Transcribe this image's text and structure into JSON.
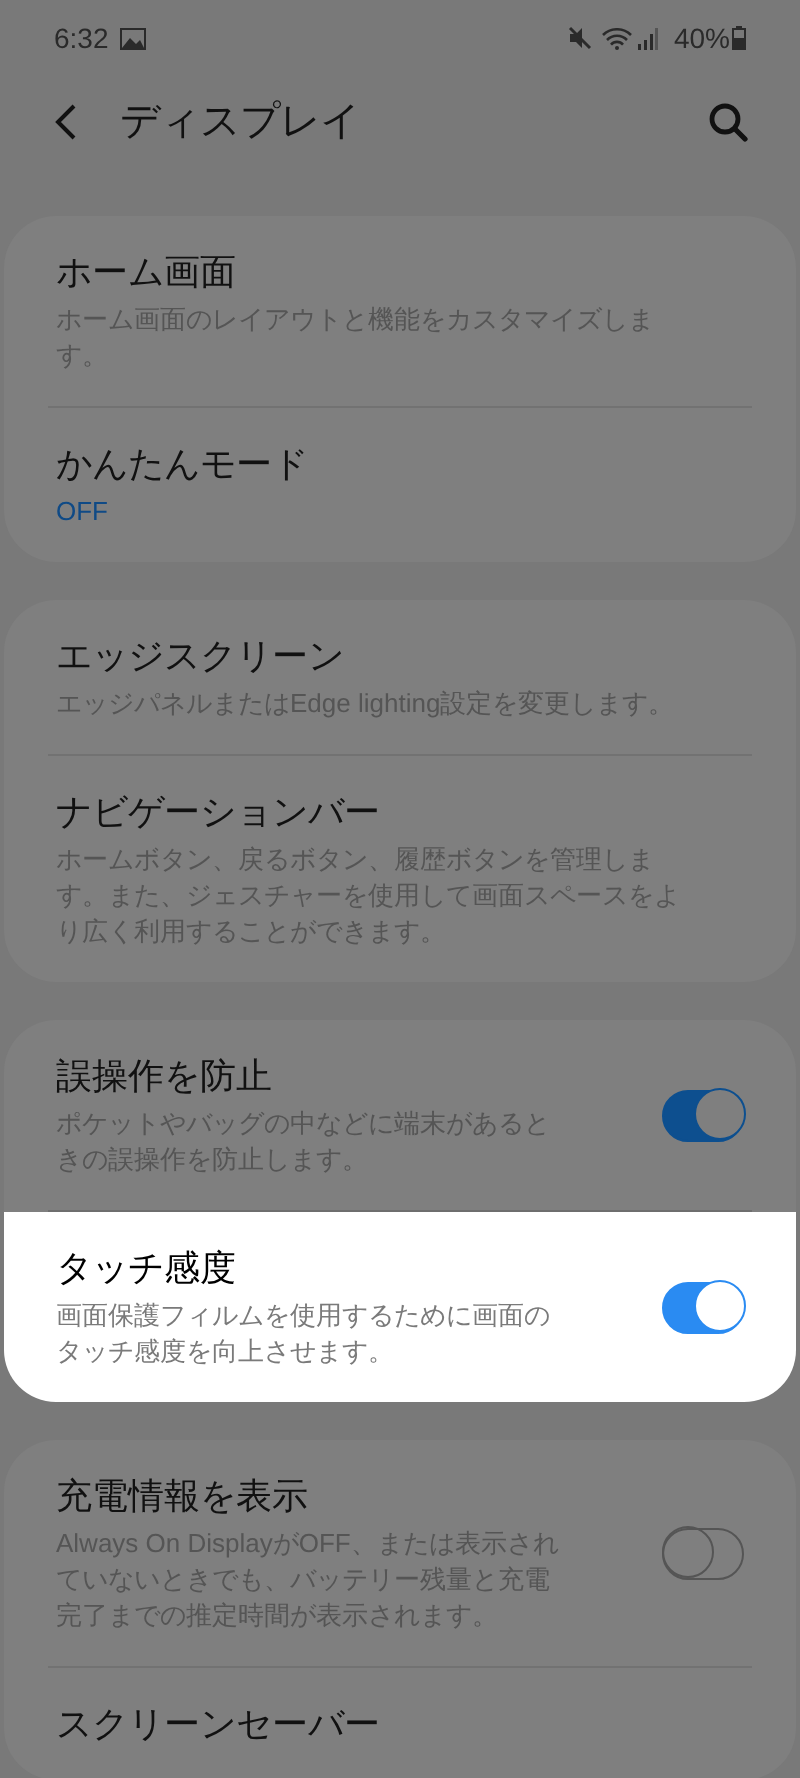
{
  "status_bar": {
    "time": "6:32",
    "battery": "40%"
  },
  "header": {
    "title": "ディスプレイ"
  },
  "groups": [
    {
      "items": [
        {
          "kind": "link",
          "title": "ホーム画面",
          "subtitle": "ホーム画面のレイアウトと機能をカスタマイズします。",
          "highlighted": false
        },
        {
          "kind": "value",
          "title": "かんたんモード",
          "value": "OFF",
          "highlighted": false
        }
      ]
    },
    {
      "items": [
        {
          "kind": "link",
          "title": "エッジスクリーン",
          "subtitle": "エッジパネルまたはEdge lighting設定を変更します。",
          "highlighted": false
        },
        {
          "kind": "link",
          "title": "ナビゲーションバー",
          "subtitle": "ホームボタン、戻るボタン、履歴ボタンを管理します。また、ジェスチャーを使用して画面スペースをより広く利用することができます。",
          "highlighted": false
        }
      ]
    },
    {
      "items": [
        {
          "kind": "toggle",
          "title": "誤操作を防止",
          "subtitle": "ポケットやバッグの中などに端末があるときの誤操作を防止します。",
          "on": true,
          "highlighted": false
        },
        {
          "kind": "toggle",
          "title": "タッチ感度",
          "subtitle": "画面保護フィルムを使用するために画面のタッチ感度を向上させます。",
          "on": true,
          "highlighted": true
        }
      ]
    },
    {
      "items": [
        {
          "kind": "toggle",
          "title": "充電情報を表示",
          "subtitle": "Always On DisplayがOFF、または表示されていないときでも、バッテリー残量と充電完了までの推定時間が表示されます。",
          "on": false,
          "highlighted": false
        },
        {
          "kind": "link",
          "title": "スクリーンセーバー",
          "highlighted": false
        }
      ]
    }
  ]
}
